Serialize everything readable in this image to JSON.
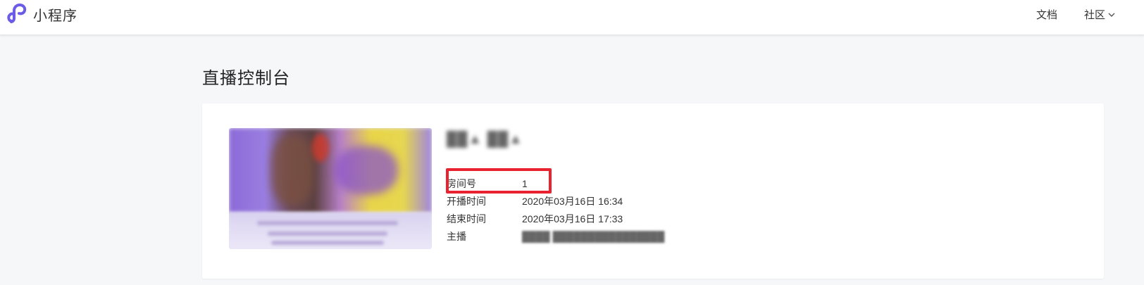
{
  "header": {
    "brand_name": "小程序",
    "nav": [
      {
        "label": "文档"
      },
      {
        "label": "社区"
      }
    ],
    "colors": {
      "logo": "#6b5ce7"
    }
  },
  "page": {
    "title": "直播控制台"
  },
  "live_room": {
    "cover_icon": "blurred-cover-image",
    "title_obscured": "██▲ ██▲",
    "fields": [
      {
        "label": "房间号",
        "value": "1"
      },
      {
        "label": "开播时间",
        "value": "2020年03月16日 16:34"
      },
      {
        "label": "结束时间",
        "value": "2020年03月16日 17:33"
      },
      {
        "label": "主播",
        "value": "████ ████████████████"
      }
    ],
    "highlight_color": "#e8232f"
  }
}
